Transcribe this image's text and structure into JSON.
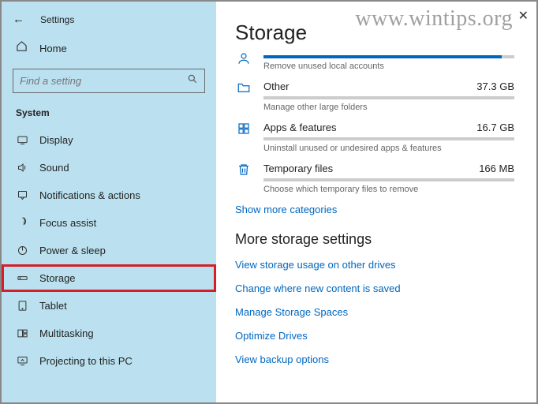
{
  "watermark": "www.wintips.org",
  "close_glyph": "✕",
  "header": {
    "back_glyph": "←",
    "title": "Settings"
  },
  "sidebar": {
    "home": "Home",
    "search_placeholder": "Find a setting",
    "group": "System",
    "items": [
      {
        "label": "Display"
      },
      {
        "label": "Sound"
      },
      {
        "label": "Notifications & actions"
      },
      {
        "label": "Focus assist"
      },
      {
        "label": "Power & sleep"
      },
      {
        "label": "Storage"
      },
      {
        "label": "Tablet"
      },
      {
        "label": "Multitasking"
      },
      {
        "label": "Projecting to this PC"
      }
    ]
  },
  "content": {
    "title": "Storage",
    "categories": [
      {
        "name": "",
        "value": "",
        "desc": "Remove unused local accounts",
        "fill": 95
      },
      {
        "name": "Other",
        "value": "37.3 GB",
        "desc": "Manage other large folders",
        "fill": 0
      },
      {
        "name": "Apps & features",
        "value": "16.7 GB",
        "desc": "Uninstall unused or undesired apps & features",
        "fill": 0
      },
      {
        "name": "Temporary files",
        "value": "166 MB",
        "desc": "Choose which temporary files to remove",
        "fill": 0
      }
    ],
    "show_more": "Show more categories",
    "more_title": "More storage settings",
    "more_links": [
      "View storage usage on other drives",
      "Change where new content is saved",
      "Manage Storage Spaces",
      "Optimize Drives",
      "View backup options"
    ]
  }
}
